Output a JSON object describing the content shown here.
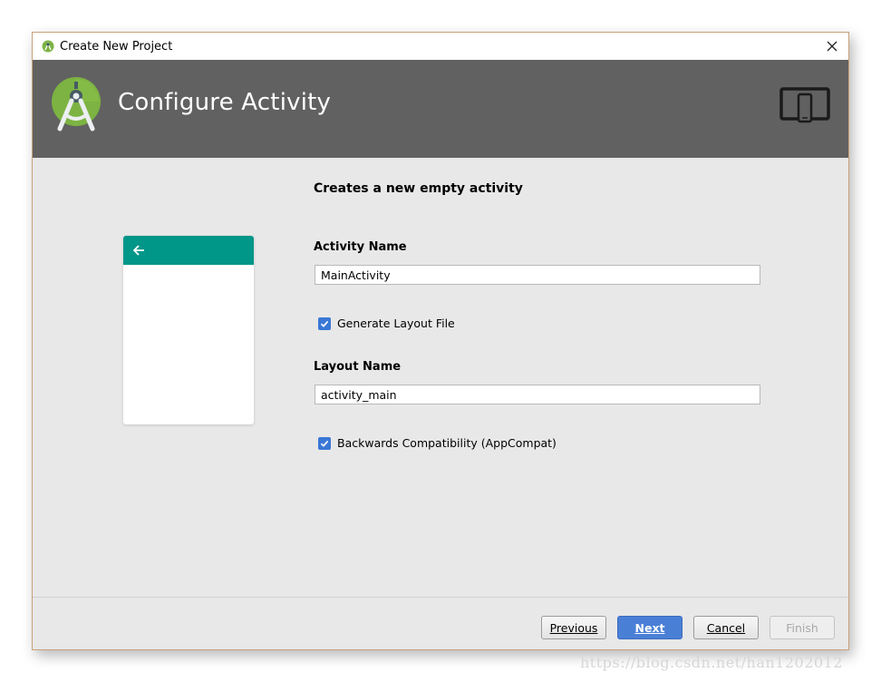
{
  "window": {
    "title": "Create New Project"
  },
  "header": {
    "title": "Configure Activity"
  },
  "form": {
    "description": "Creates a new empty activity",
    "activity_name_label": "Activity Name",
    "activity_name_value": "MainActivity",
    "generate_layout_label": "Generate Layout File",
    "generate_layout_checked": true,
    "layout_name_label": "Layout Name",
    "layout_name_value": "activity_main",
    "appcompat_label": "Backwards Compatibility (AppCompat)",
    "appcompat_checked": true
  },
  "buttons": {
    "previous": "Previous",
    "next": "Next",
    "cancel": "Cancel",
    "finish": "Finish"
  },
  "colors": {
    "header_bg": "#616161",
    "preview_appbar": "#009688",
    "primary_button": "#4a7fd6",
    "checkbox": "#3a77d6"
  },
  "icons": [
    "android-studio-icon",
    "close-icon",
    "android-studio-logo",
    "device-form-factor-icon",
    "back-arrow-icon",
    "checkbox-checked-icon"
  ],
  "watermark": "https://blog.csdn.net/han1202012"
}
